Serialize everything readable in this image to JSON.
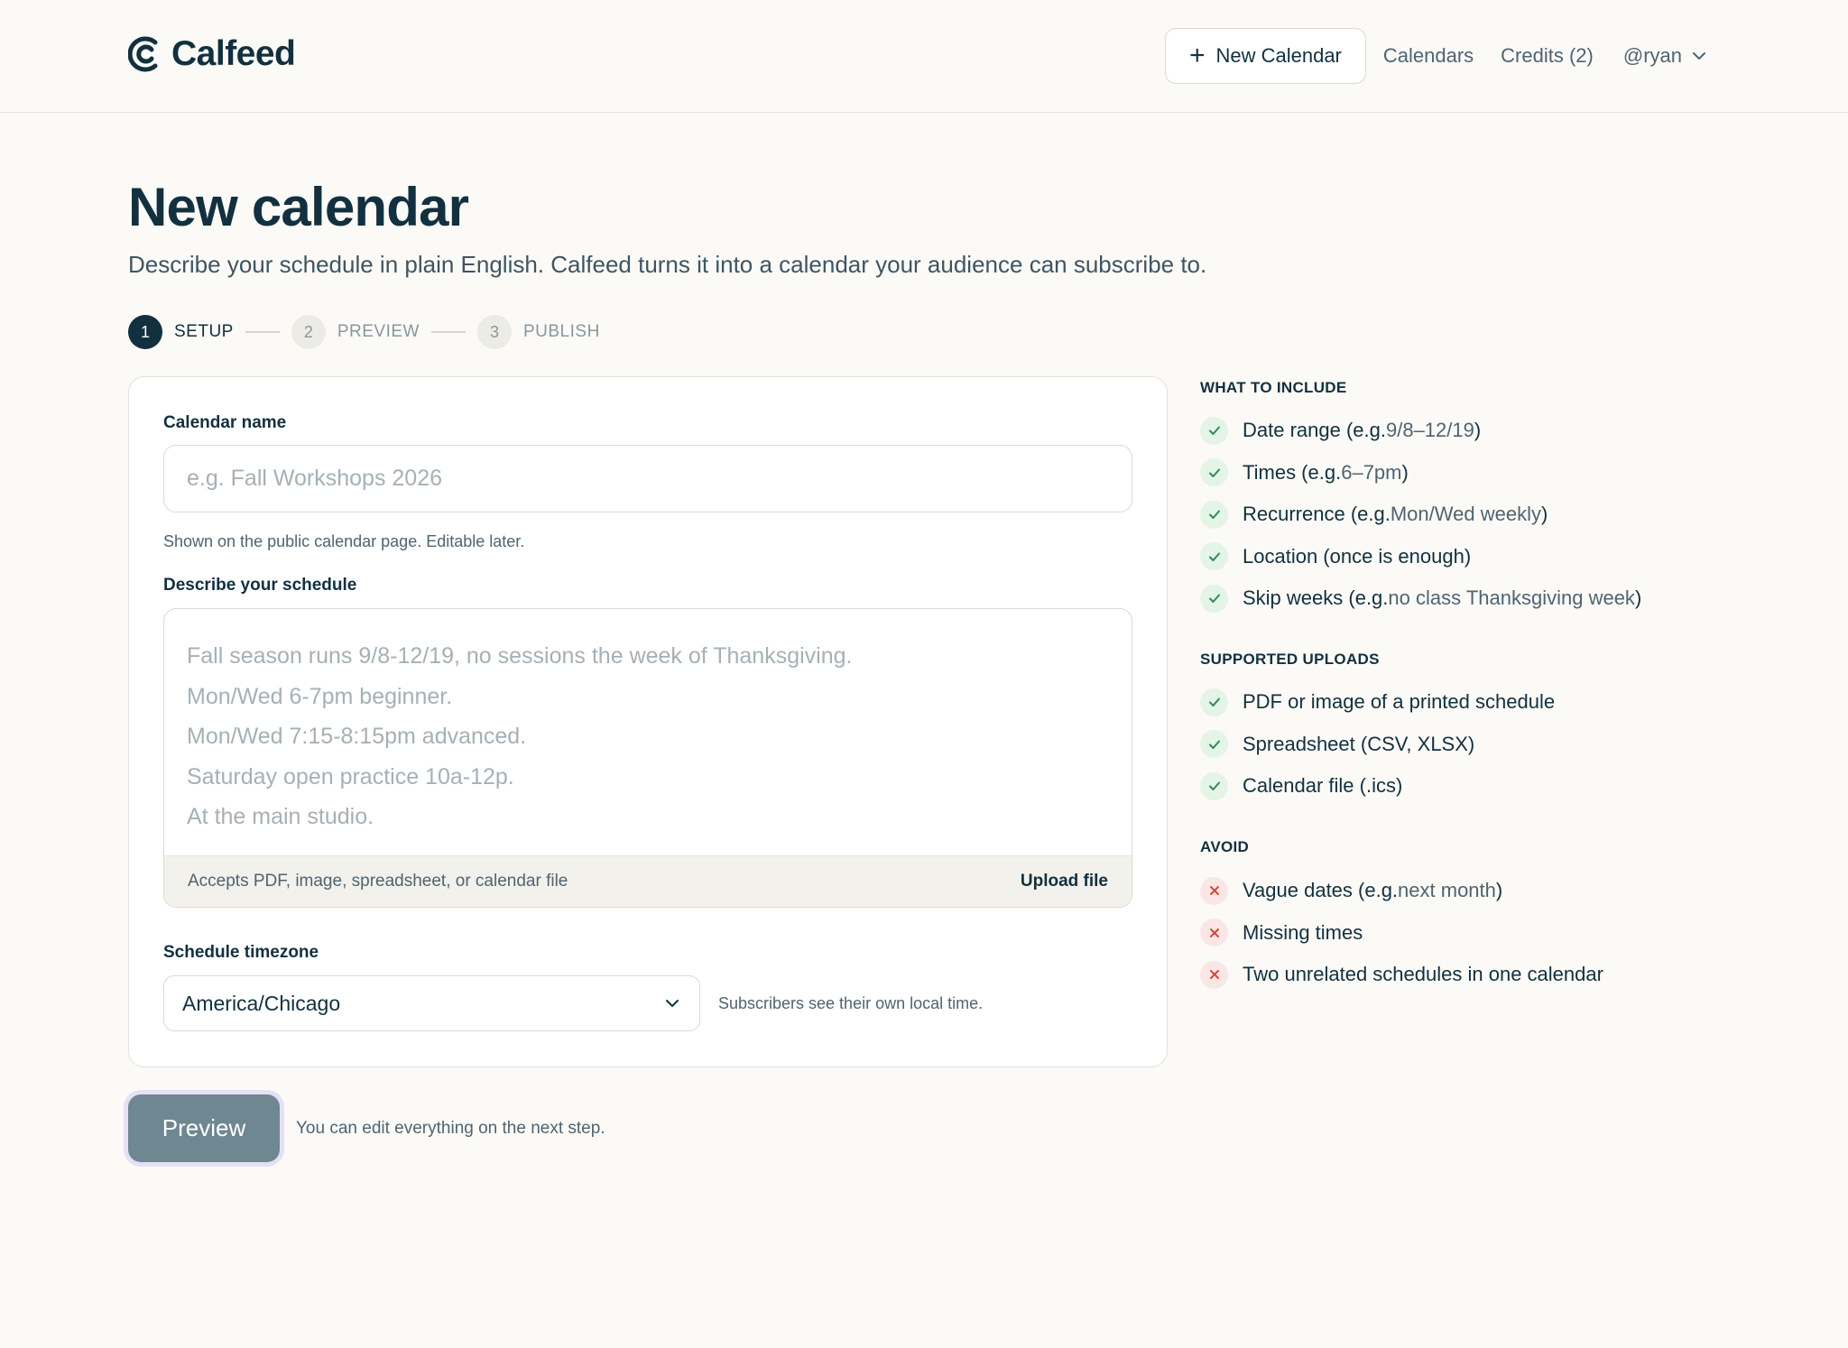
{
  "header": {
    "logo_text": "Calfeed",
    "new_calendar_label": "New Calendar",
    "nav_calendars": "Calendars",
    "nav_credits": "Credits (2)",
    "user_handle": "@ryan"
  },
  "page": {
    "title": "New calendar",
    "subtitle": "Describe your schedule in plain English. Calfeed turns it into a calendar your audience can subscribe to."
  },
  "stepper": [
    {
      "num": "1",
      "label": "SETUP",
      "active": true
    },
    {
      "num": "2",
      "label": "PREVIEW",
      "active": false
    },
    {
      "num": "3",
      "label": "PUBLISH",
      "active": false
    }
  ],
  "form": {
    "name_label": "Calendar name",
    "name_placeholder": "e.g. Fall Workshops 2026",
    "name_value": "",
    "name_help": "Shown on the public calendar page. Editable later.",
    "schedule_label": "Describe your schedule",
    "schedule_placeholder": "Fall season runs 9/8-12/19, no sessions the week of Thanksgiving.\nMon/Wed 6-7pm beginner.\nMon/Wed 7:15-8:15pm advanced.\nSaturday open practice 10a-12p.\nAt the main studio.",
    "schedule_value": "",
    "upload_note": "Accepts PDF, image, spreadsheet, or calendar file",
    "upload_label": "Upload file",
    "timezone_label": "Schedule timezone",
    "timezone_value": "America/Chicago",
    "timezone_note": "Subscribers see their own local time."
  },
  "actions": {
    "preview_label": "Preview",
    "preview_note": "You can edit everything on the next step."
  },
  "sidebar": {
    "include_heading": "WHAT TO INCLUDE",
    "include_items": [
      {
        "text": "Date range (e.g. ",
        "example": "9/8–12/19",
        "suffix": ")"
      },
      {
        "text": "Times (e.g. ",
        "example": "6–7pm",
        "suffix": ")"
      },
      {
        "text": "Recurrence (e.g. ",
        "example": "Mon/Wed weekly",
        "suffix": ")"
      },
      {
        "text": "Location (once is enough)",
        "example": "",
        "suffix": ""
      },
      {
        "text": "Skip weeks (e.g. ",
        "example": "no class Thanksgiving week",
        "suffix": ")"
      }
    ],
    "uploads_heading": "SUPPORTED UPLOADS",
    "uploads_items": [
      {
        "text": "PDF or image of a printed schedule"
      },
      {
        "text": "Spreadsheet (CSV, XLSX)"
      },
      {
        "text": "Calendar file (.ics)"
      }
    ],
    "avoid_heading": "AVOID",
    "avoid_items": [
      {
        "text": "Vague dates (e.g. ",
        "example": "next month",
        "suffix": ")"
      },
      {
        "text": "Missing times",
        "example": "",
        "suffix": ""
      },
      {
        "text": "Two unrelated schedules in one calendar",
        "example": "",
        "suffix": ""
      }
    ],
    "colors": {
      "ok": "#2e8b57",
      "no": "#d9453c"
    }
  }
}
